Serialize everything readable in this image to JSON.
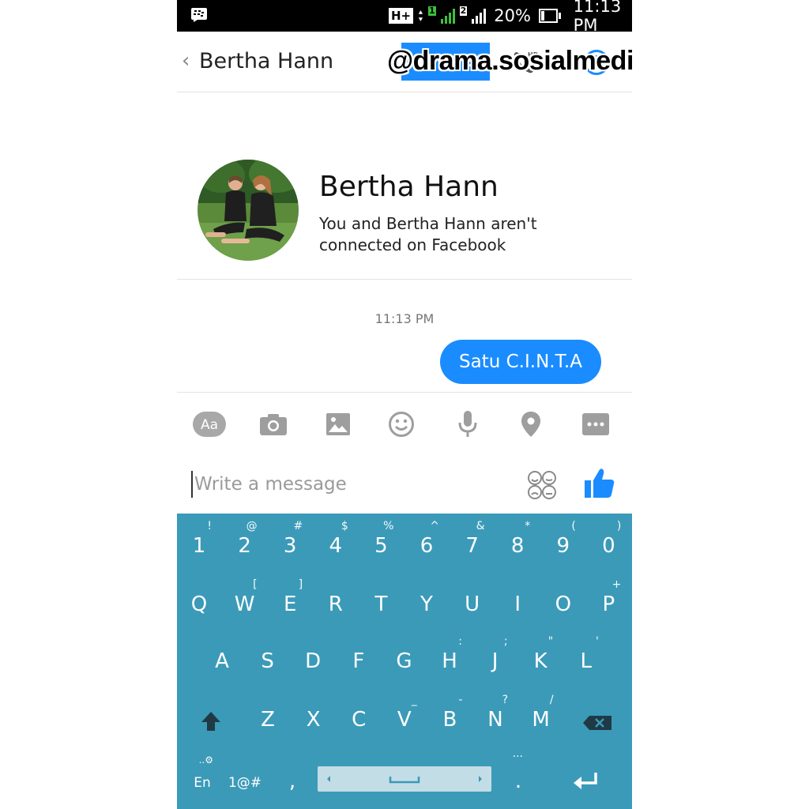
{
  "status_bar": {
    "network_type": "H+",
    "sim2_label": "2",
    "battery_percent": "20%",
    "battery_level": 0.2,
    "time": "11:13 PM"
  },
  "header": {
    "back_icon": "chevron-left-icon",
    "contact_name": "Bertha Hann",
    "invite_label": "INVITE",
    "call_icon": "hd-phone-icon",
    "call_badge": "HD",
    "info_icon": "info-icon"
  },
  "watermark": "@drama.sosialmedia",
  "profile": {
    "name": "Bertha Hann",
    "subtitle": "You and Bertha Hann aren't connected on Facebook"
  },
  "messages": {
    "timestamp": "11:13 PM",
    "items": [
      {
        "text": "Satu C.I.N.T.A",
        "sender": "me"
      }
    ]
  },
  "toolbar": {
    "items": [
      {
        "icon": "text-format-icon",
        "label": "Aa"
      },
      {
        "icon": "camera-icon"
      },
      {
        "icon": "image-icon"
      },
      {
        "icon": "emoji-icon"
      },
      {
        "icon": "microphone-icon"
      },
      {
        "icon": "location-icon"
      },
      {
        "icon": "more-icon"
      }
    ]
  },
  "composer": {
    "placeholder": "Write a message",
    "emoticons_icon": "emoticons-icon",
    "like_icon": "thumbs-up-icon"
  },
  "keyboard": {
    "color": "#3b9ab8",
    "number_row": [
      {
        "main": "1",
        "alt": "!"
      },
      {
        "main": "2",
        "alt": "@"
      },
      {
        "main": "3",
        "alt": "#"
      },
      {
        "main": "4",
        "alt": "$"
      },
      {
        "main": "5",
        "alt": "%"
      },
      {
        "main": "6",
        "alt": "^"
      },
      {
        "main": "7",
        "alt": "&"
      },
      {
        "main": "8",
        "alt": "*"
      },
      {
        "main": "9",
        "alt": "("
      },
      {
        "main": "0",
        "alt": ")"
      }
    ],
    "row_q": [
      {
        "main": "Q",
        "alt": ""
      },
      {
        "main": "W",
        "alt": "["
      },
      {
        "main": "E",
        "alt": "]"
      },
      {
        "main": "R",
        "alt": ""
      },
      {
        "main": "T",
        "alt": ""
      },
      {
        "main": "Y",
        "alt": ""
      },
      {
        "main": "U",
        "alt": ""
      },
      {
        "main": "I",
        "alt": ""
      },
      {
        "main": "O",
        "alt": ""
      },
      {
        "main": "P",
        "alt": "+"
      }
    ],
    "row_a": [
      {
        "main": "A",
        "alt": ""
      },
      {
        "main": "S",
        "alt": ""
      },
      {
        "main": "D",
        "alt": ""
      },
      {
        "main": "F",
        "alt": ""
      },
      {
        "main": "G",
        "alt": ""
      },
      {
        "main": "H",
        "alt": ":"
      },
      {
        "main": "J",
        "alt": ";"
      },
      {
        "main": "K",
        "alt": "\""
      },
      {
        "main": "L",
        "alt": "'"
      }
    ],
    "row_z": [
      {
        "main": "Z",
        "alt": ""
      },
      {
        "main": "X",
        "alt": ""
      },
      {
        "main": "C",
        "alt": ""
      },
      {
        "main": "V",
        "alt": "_"
      },
      {
        "main": "B",
        "alt": "-"
      },
      {
        "main": "N",
        "alt": "?"
      },
      {
        "main": "M",
        "alt": "/"
      }
    ],
    "shift_icon": "shift-icon",
    "backspace_icon": "backspace-icon",
    "lang_label": "En",
    "lang_alt": "..⚙",
    "symbols_label": "1@#",
    "comma_label": ",",
    "period_label": ".",
    "period_alt": "...",
    "space_icon": "space-icon",
    "enter_icon": "enter-icon"
  }
}
